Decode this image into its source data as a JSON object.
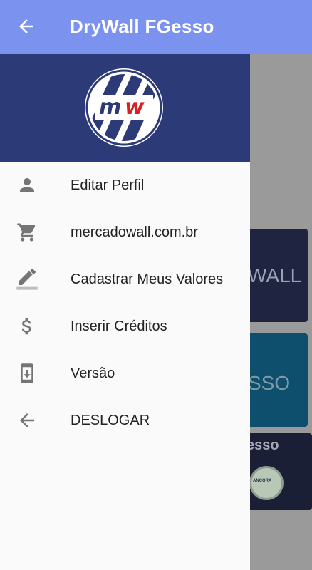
{
  "app_bar": {
    "title": "DryWall FGesso",
    "back_icon": "arrow-back-icon"
  },
  "drawer": {
    "header": {
      "logo_text": "mw",
      "logo_colors": {
        "m": "#2d3a78",
        "w": "#d92027",
        "stripes": "#2d3a78"
      }
    },
    "items": [
      {
        "label": "Editar Perfil",
        "icon": "person-icon"
      },
      {
        "label": "mercadowall.com.br",
        "icon": "shopping-cart-icon"
      },
      {
        "label": "Cadastrar Meus Valores",
        "icon": "pencil-icon"
      },
      {
        "label": "Inserir Créditos",
        "icon": "dollar-icon"
      },
      {
        "label": "Versão",
        "icon": "phone-download-icon"
      },
      {
        "label": "DESLOGAR",
        "icon": "arrow-back-icon"
      }
    ]
  },
  "background": {
    "cards": [
      {
        "text": "WALL"
      },
      {
        "text": "SSO"
      },
      {
        "text": "esso",
        "badge_text": "ANCORA"
      }
    ]
  },
  "colors": {
    "app_bar": "#7b92ee",
    "drawer_header": "#2d3a78",
    "icon": "#757575"
  }
}
